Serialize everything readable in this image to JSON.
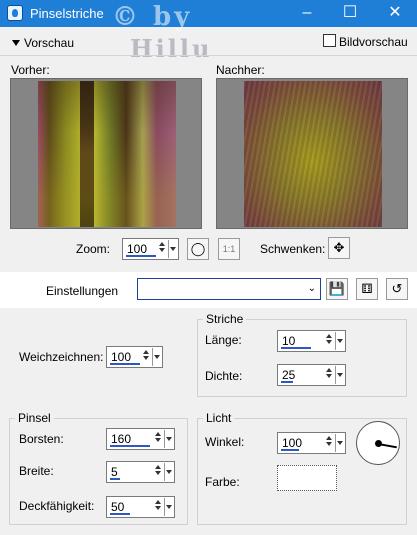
{
  "window": {
    "title": "Pinselstriche",
    "minimize": "–",
    "maximize": "☐",
    "close": "✕",
    "watermark_line1": "© by",
    "watermark_line2": "Hillu"
  },
  "preview_section": {
    "label": "Vorschau",
    "bildvorschau_label": "Bildvorschau",
    "bildvorschau_checked": false
  },
  "previews": {
    "before_label": "Vorher:",
    "after_label": "Nachher:"
  },
  "zoom": {
    "label": "Zoom:",
    "value": "100",
    "fit_button": "1:1"
  },
  "pan": {
    "label": "Schwenken:"
  },
  "settings": {
    "label": "Einstellungen",
    "value": ""
  },
  "striche": {
    "title": "Striche",
    "laenge_label": "Länge:",
    "laenge_value": "10",
    "dichte_label": "Dichte:",
    "dichte_value": "25"
  },
  "weichzeichnen": {
    "label": "Weichzeichnen:",
    "value": "100"
  },
  "pinsel": {
    "title": "Pinsel",
    "borsten_label": "Borsten:",
    "borsten_value": "160",
    "breite_label": "Breite:",
    "breite_value": "5",
    "deckfaehigkeit_label": "Deckfähigkeit:",
    "deckfaehigkeit_value": "50"
  },
  "licht": {
    "title": "Licht",
    "winkel_label": "Winkel:",
    "winkel_value": "100",
    "farbe_label": "Farbe:"
  },
  "colors": {
    "titlebar": "#1f7fd6",
    "focus_border": "#1e3f9a",
    "light_color": "#ffffff"
  }
}
